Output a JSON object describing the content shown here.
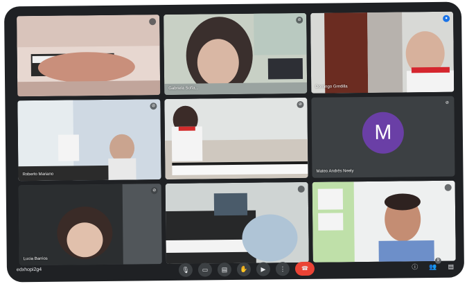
{
  "participants": [
    {
      "name": "",
      "mic": ""
    },
    {
      "name": "Gabriela Sofía...",
      "mic": "⊘"
    },
    {
      "name": "Domingo Gredilla",
      "mic": "●"
    },
    {
      "name": "Roberto Mariano",
      "mic": "⊘"
    },
    {
      "name": "",
      "mic": "⊘"
    },
    {
      "name": "Mateo Andrés Neely",
      "mic": "⊘",
      "initial": "M"
    },
    {
      "name": "Lucia Barrios",
      "mic": "⊘"
    },
    {
      "name": "",
      "mic": ""
    },
    {
      "name": "",
      "mic": ""
    }
  ],
  "meeting": {
    "code": "edxhopi2g4"
  },
  "controls": {
    "mic_icon": "🎙",
    "camera_icon": "▭",
    "captions_icon": "▤",
    "hand_icon": "✋",
    "present_icon": "▶",
    "more_icon": "⋮",
    "end_icon": "☎"
  },
  "right_icons": {
    "info_icon": "ⓘ",
    "people_icon": "👥",
    "people_count": "9",
    "chat_icon": "▤"
  }
}
